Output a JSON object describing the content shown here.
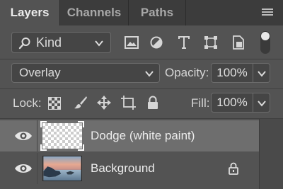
{
  "tabs": [
    {
      "label": "Layers",
      "active": true
    },
    {
      "label": "Channels",
      "active": false
    },
    {
      "label": "Paths",
      "active": false
    }
  ],
  "filter": {
    "kind_label": "Kind",
    "icons": [
      "pixel-filter-icon",
      "adjustment-filter-icon",
      "type-filter-icon",
      "shape-filter-icon",
      "smart-object-filter-icon"
    ],
    "toggle_on": true
  },
  "blend": {
    "mode": "Overlay",
    "opacity_label": "Opacity:",
    "opacity_value": "100%"
  },
  "lock": {
    "label": "Lock:",
    "icons": [
      "lock-transparent-pixels-icon",
      "lock-image-pixels-icon",
      "lock-position-icon",
      "lock-artboard-icon",
      "lock-all-icon"
    ],
    "fill_label": "Fill:",
    "fill_value": "100%"
  },
  "layers": [
    {
      "name": "Dodge (white paint)",
      "visible": true,
      "selected": true,
      "thumbnail": "transparent"
    },
    {
      "name": "Background",
      "visible": true,
      "selected": false,
      "thumbnail": "seascape",
      "locked": true
    }
  ],
  "colors": {
    "panel_bg": "#535353",
    "tab_bar_bg": "#3c3c3c",
    "selected_layer_bg": "#6e6e6e",
    "field_bg": "#454545"
  }
}
